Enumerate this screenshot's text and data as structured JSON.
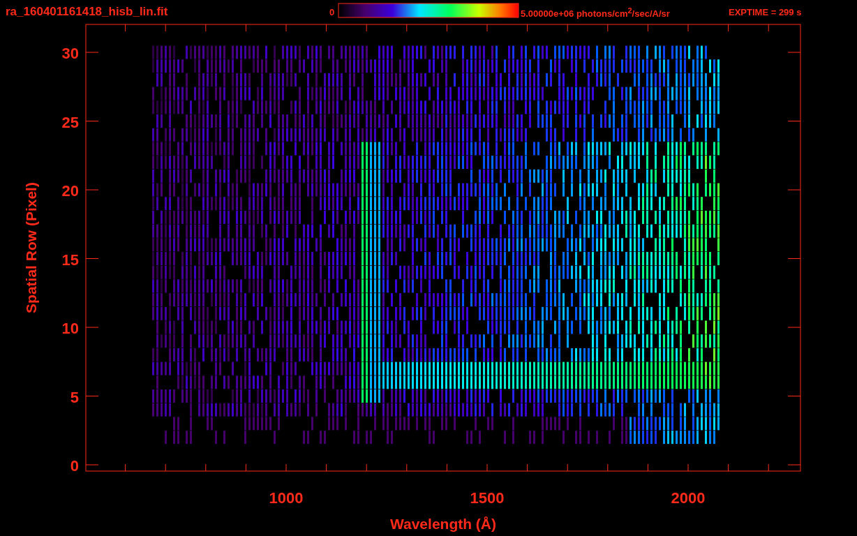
{
  "header": {
    "file_name": "ra_160401161418_hisb_lin.fit",
    "colorbar_min": "0",
    "colorbar_max": "5.00000e+06 photons/cm$^{2}$/sec/A/sr",
    "exposure": "EXPTIME = 299 s"
  },
  "plot": {
    "xlabel": "Wavelength (Å)",
    "ylabel": "Spatial Row (Pixel)",
    "xticks": [
      "1000",
      "1500",
      "2000"
    ],
    "yticks": [
      "30",
      "25",
      "20",
      "15",
      "10",
      "5",
      "0"
    ]
  }
}
